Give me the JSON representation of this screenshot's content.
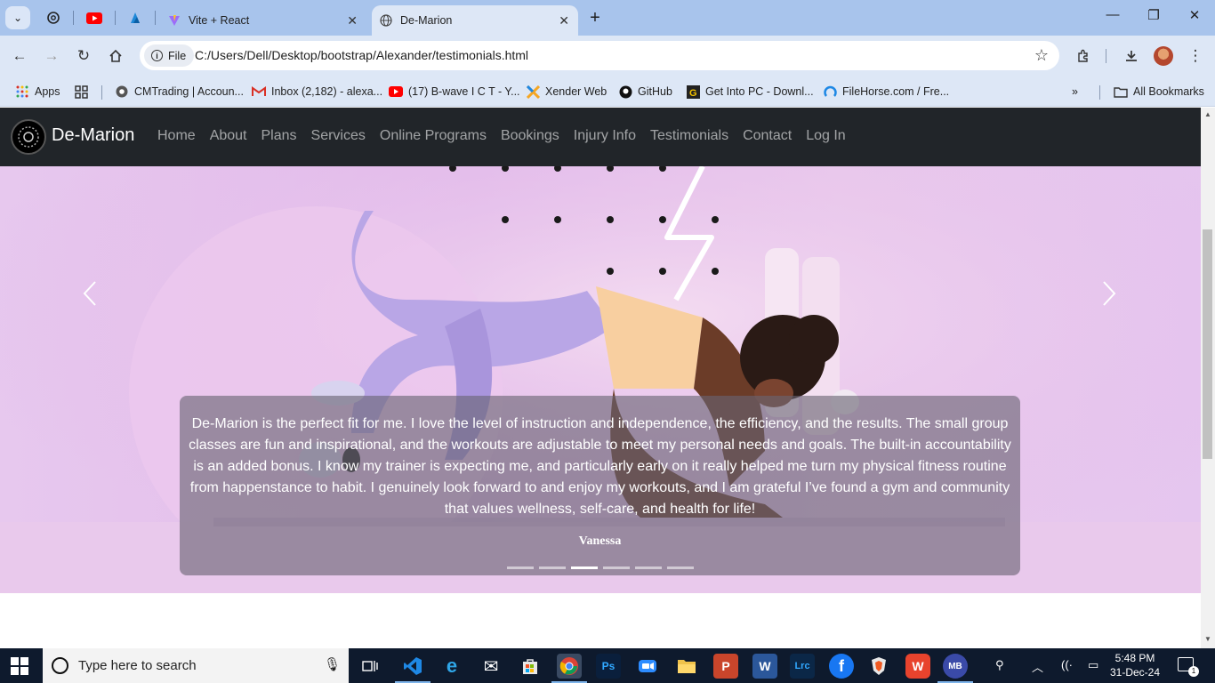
{
  "browser": {
    "tabs": [
      {
        "title": "Vite + React",
        "icon": "vite-icon",
        "active": false
      },
      {
        "title": "De-Marion",
        "icon": "globe-icon",
        "active": true
      }
    ],
    "pinned_icons": [
      "openai-icon",
      "youtube-icon",
      "azure-icon"
    ],
    "address": {
      "chip": "File",
      "url": "C:/Users/Dell/Desktop/bootstrap/Alexander/testimonials.html"
    },
    "bookmarks": [
      {
        "label": "Apps",
        "icon": "apps-grid-icon"
      },
      {
        "label": "",
        "icon": "tab-groups-icon"
      },
      {
        "label": "CMTrading | Accoun...",
        "icon": "chrome-icon"
      },
      {
        "label": "Inbox (2,182) - alexa...",
        "icon": "gmail-icon"
      },
      {
        "label": "(17) B-wave I C T - Y...",
        "icon": "youtube-icon"
      },
      {
        "label": "Xender Web",
        "icon": "xender-icon"
      },
      {
        "label": "GitHub",
        "icon": "github-icon"
      },
      {
        "label": "Get Into PC - Downl...",
        "icon": "getintopc-icon"
      },
      {
        "label": "FileHorse.com / Fre...",
        "icon": "filehorse-icon"
      }
    ],
    "more_bookmarks": "»",
    "all_bookmarks": "All Bookmarks"
  },
  "site": {
    "brand": "De-Marion",
    "nav": [
      "Home",
      "About",
      "Plans",
      "Services",
      "Online Programs",
      "Bookings",
      "Injury Info",
      "Testimonials",
      "Contact",
      "Log In"
    ],
    "carousel": {
      "prev": "‹",
      "next": "›",
      "quote": "De-Marion is the perfect fit for me. I love the level of instruction and independence, the efficiency, and the results. The small group classes are fun and inspirational, and the workouts are adjustable to meet my personal needs and goals. The built-in accountability is an added bonus. I know my trainer is expecting me, and particularly early on it really helped me turn my physical fitness routine from happenstance to habit. I genuinely look forward to and enjoy my workouts, and I am grateful I’ve found a gym and community that values wellness, self-care, and health for life!",
      "author": "Vanessa",
      "slide_count": 6,
      "active_slide": 3
    }
  },
  "taskbar": {
    "search_placeholder": "Type here to search",
    "time": "5:48 PM",
    "date": "31-Dec-24",
    "notification_count": "1",
    "apps": [
      {
        "name": "task-view-icon",
        "label": "",
        "color": "#0e1a2d"
      },
      {
        "name": "vscode-icon",
        "label": "",
        "color": "#1e7bd6"
      },
      {
        "name": "edge-icon",
        "label": "e",
        "color": "#1a8ad4"
      },
      {
        "name": "mail-icon",
        "label": "✉",
        "color": "#0e1a2d"
      },
      {
        "name": "store-icon",
        "label": "",
        "color": "#0e1a2d"
      },
      {
        "name": "chrome-icon",
        "label": "",
        "color": "#0e1a2d"
      },
      {
        "name": "photoshop-icon",
        "label": "Ps",
        "color": "#0a1f3c"
      },
      {
        "name": "zoom-icon",
        "label": "",
        "color": "#2d8cff"
      },
      {
        "name": "file-explorer-icon",
        "label": "",
        "color": "#f0c24a"
      },
      {
        "name": "powerpoint-icon",
        "label": "P",
        "color": "#c9452b"
      },
      {
        "name": "word-icon",
        "label": "W",
        "color": "#2b579a"
      },
      {
        "name": "lightroom-classic-icon",
        "label": "Lrc",
        "color": "#0b2747"
      },
      {
        "name": "facebook-icon",
        "label": "f",
        "color": "#1877f2"
      },
      {
        "name": "brave-icon",
        "label": "",
        "color": "#e8e8e8"
      },
      {
        "name": "wps-icon",
        "label": "W",
        "color": "#e8432d"
      },
      {
        "name": "malwarebytes-icon",
        "label": "MB",
        "color": "#3a4aa8"
      }
    ]
  }
}
